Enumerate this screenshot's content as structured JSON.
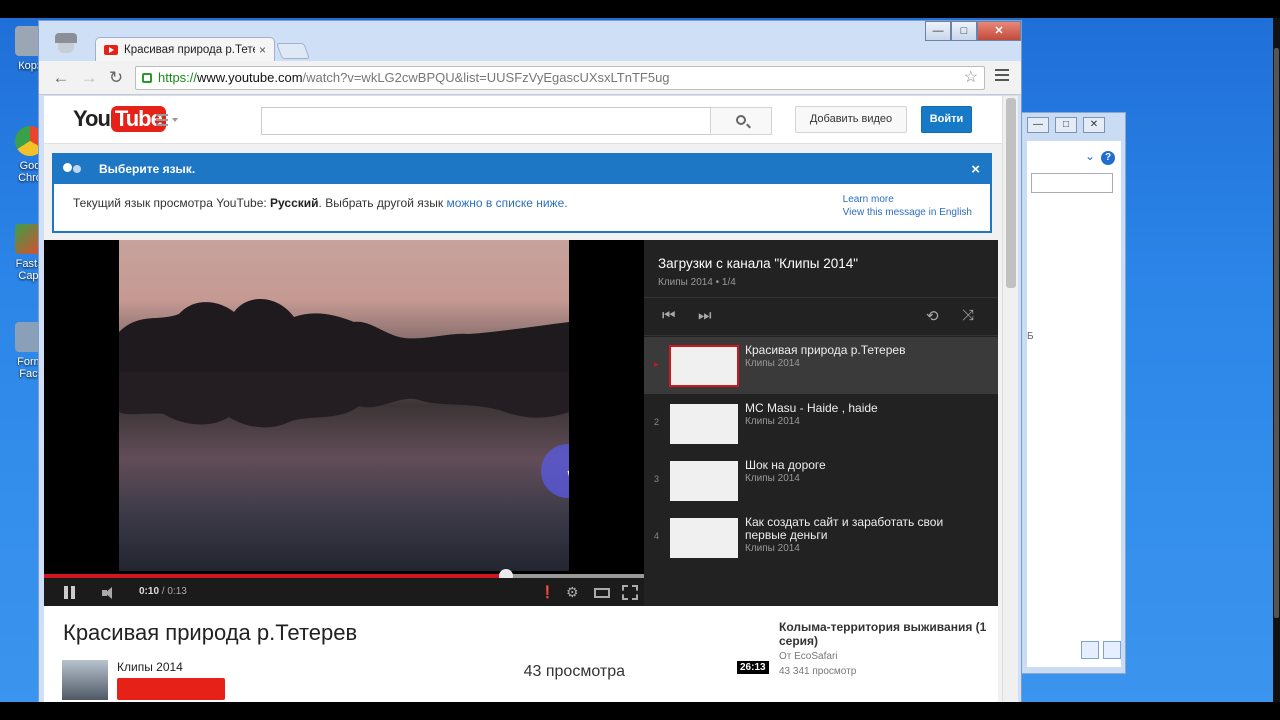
{
  "desktop": {
    "icons": [
      {
        "label": "Корз",
        "color": "#9aa6b4"
      },
      {
        "label": "Goo Chro",
        "color": "#e8452c"
      },
      {
        "label": "FastS Capt",
        "color": "#3aa04a"
      },
      {
        "label": "Form Fact",
        "color": "#8aa0b8"
      }
    ]
  },
  "explorer": {
    "min_label": "—",
    "max_label": "□",
    "close_label": "✕",
    "help_label": "?",
    "partial_label": "Б"
  },
  "browser": {
    "tab_title": "Красивая природа р.Тетерев",
    "tab_close": "×",
    "window_buttons": {
      "min": "—",
      "max": "□",
      "close": "✕"
    },
    "nav": {
      "back": "←",
      "forward": "→",
      "reload": "↻"
    },
    "url": {
      "scheme": "https://",
      "host": "www.youtube.com",
      "path": "/watch?v=wkLG2cwBPQU&list=UUSFzVyEgascUXsxLTnTF5ug"
    },
    "star": "☆"
  },
  "youtube": {
    "logo_you": "You",
    "logo_tube": "Tube",
    "search_placeholder": "",
    "upload_label": "Добавить видео",
    "signin_label": "Войти"
  },
  "language_bar": {
    "title": "Выберите язык.",
    "close": "×",
    "text_prefix": "Текущий язык просмотра YouTube: ",
    "current_language": "Русский",
    "text_middle": ". Выбрать другой язык ",
    "text_link": "можно в списке ниже.",
    "learn_more": "Learn more",
    "view_english": "View this message in English"
  },
  "player": {
    "current_time": "0:10",
    "separator": " / ",
    "duration": "0:13",
    "played_fraction": 0.77,
    "loaded_fraction": 1.0,
    "icons": [
      "pause-icon",
      "volume-icon",
      "annotations-icon",
      "settings-gear-icon",
      "theater-icon",
      "fullscreen-icon"
    ]
  },
  "playlist": {
    "title": "Загрузки с канала \"Клипы 2014\"",
    "subtitle": "Клипы 2014 • 1/4",
    "controls": {
      "prev": "⏮",
      "next": "⏭",
      "loop": "⟲",
      "shuffle": "⤨"
    },
    "items": [
      {
        "index": "▸",
        "title": "Красивая природа р.Тетерев",
        "channel": "Клипы 2014",
        "active": true
      },
      {
        "index": "2",
        "title": "MC Masu - Haide , haide",
        "channel": "Клипы 2014",
        "active": false
      },
      {
        "index": "3",
        "title": "Шок на дороге",
        "channel": "Клипы 2014",
        "active": false
      },
      {
        "index": "4",
        "title": "Как создать сайт и заработать свои первые деньги",
        "channel": "Клипы 2014",
        "active": false
      }
    ]
  },
  "video_info": {
    "title": "Красивая природа р.Тетерев",
    "channel": "Клипы 2014",
    "views": "43 просмотра"
  },
  "related": {
    "title": "Колыма-территория выживания (1 серия)",
    "by": "От EcoSafari",
    "views": "43 341 просмотр",
    "duration": "26:13"
  }
}
